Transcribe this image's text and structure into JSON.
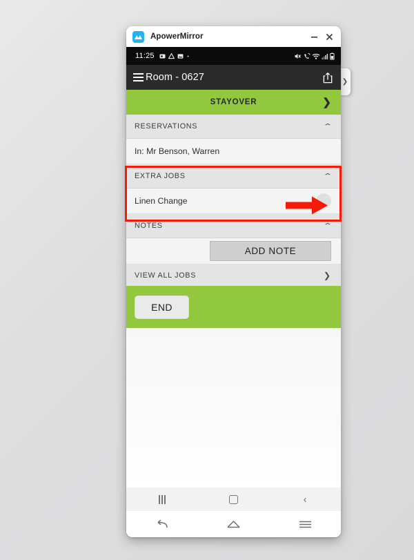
{
  "window": {
    "app_title": "ApowerMirror",
    "logo_icon": "apowermirror-logo-icon",
    "minimize_icon": "minimize-icon",
    "close_icon": "close-icon"
  },
  "edge_tab": {
    "icon": "chevron-right-icon",
    "glyph": "❯"
  },
  "status_bar": {
    "time": "11:25",
    "left_icons": [
      "screen-recorder-icon",
      "google-drive-icon",
      "photos-icon",
      "more-dot-icon"
    ],
    "right_icons": [
      "mute-icon",
      "call-icon",
      "wifi-icon",
      "signal-icon",
      "battery-icon"
    ]
  },
  "app_bar": {
    "menu_icon": "hamburger-menu-icon",
    "title": "Room - 0627",
    "share_icon": "share-icon"
  },
  "stayover": {
    "label": "STAYOVER",
    "chevron": "❯",
    "chevron_icon": "chevron-right-icon",
    "color": "#92c83e"
  },
  "sections": [
    {
      "id": "reservations",
      "header": "RESERVATIONS",
      "collapse_icon": "chevron-up-icon",
      "collapse_glyph": "⌃",
      "row_label": "In: Mr Benson, Warren"
    },
    {
      "id": "extra-jobs",
      "header": "EXTRA JOBS",
      "collapse_icon": "chevron-up-icon",
      "collapse_glyph": "⌃",
      "row_label": "Linen Change",
      "toggle_state": "off"
    },
    {
      "id": "notes",
      "header": "NOTES",
      "collapse_icon": "chevron-up-icon",
      "collapse_glyph": "⌃",
      "add_note_label": "ADD NOTE"
    }
  ],
  "view_all_jobs": {
    "label": "VIEW ALL JOBS",
    "chevron": "❯",
    "chevron_icon": "chevron-right-icon"
  },
  "footer": {
    "end_label": "END",
    "color": "#92c83e"
  },
  "android_nav": {
    "recents_icon": "recents-icon",
    "home_icon": "home-square-icon",
    "back_icon": "back-chevron-icon",
    "back_glyph": "‹"
  },
  "mirror_nav": {
    "back_icon": "back-arrow-icon",
    "home_icon": "home-icon",
    "menu_icon": "menu-lines-icon"
  },
  "annotation": {
    "box_color": "#f61b09",
    "arrow_color": "#f61b09",
    "box_target": "extra-jobs-section",
    "arrow_target": "linen-change-toggle"
  }
}
